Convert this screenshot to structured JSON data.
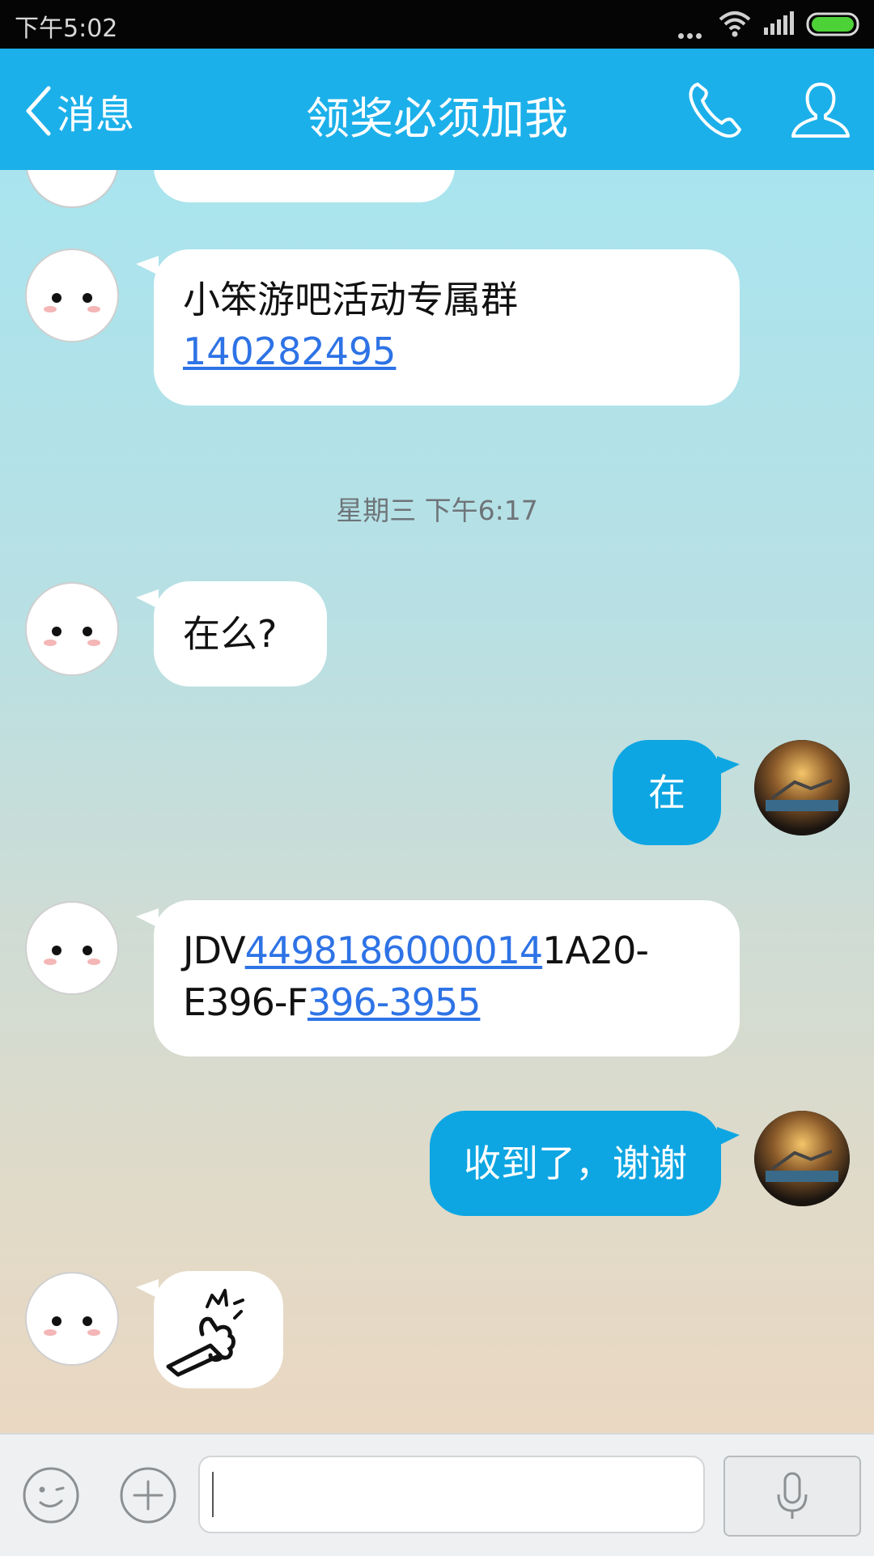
{
  "status_bar": {
    "time": "下午5:02",
    "battery_color": "#4cd137"
  },
  "header": {
    "back_label": "消息",
    "title": "领奖必须加我",
    "bg_color": "#1cb0ea"
  },
  "chat": {
    "timestamp": "星期三 下午6:17",
    "messages": [
      {
        "side": "left",
        "line1": "小笨游吧活动专属群",
        "link": "140282495"
      },
      {
        "side": "left",
        "text": "在么?"
      },
      {
        "side": "right",
        "text": "在"
      },
      {
        "side": "left",
        "part1": "JDV",
        "link1": "4498186000014",
        "part2": "1A20-",
        "part3": "E396-F",
        "link2": "396-3955"
      },
      {
        "side": "right",
        "text": "收到了，谢谢"
      },
      {
        "side": "left",
        "sticker": "thumbs-up-sticker"
      }
    ]
  },
  "input_bar": {
    "placeholder": "",
    "value": ""
  },
  "icons": [
    "back-chevron-icon",
    "phone-icon",
    "profile-icon",
    "wifi-icon",
    "signal-icon",
    "battery-icon",
    "emoji-icon",
    "plus-icon",
    "microphone-icon"
  ]
}
